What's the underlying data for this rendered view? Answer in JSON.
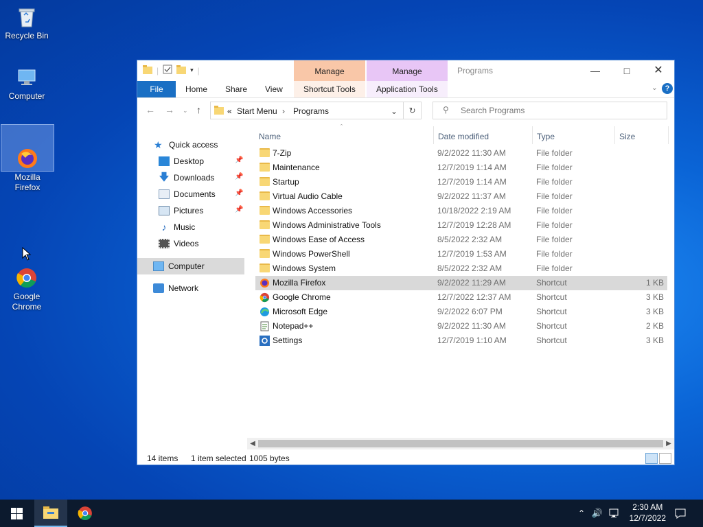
{
  "desktop": {
    "icons": [
      {
        "label": "Recycle Bin"
      },
      {
        "label": "Computer"
      },
      {
        "label": "Mozilla\nFirefox"
      },
      {
        "label": "Google\nChrome"
      }
    ]
  },
  "window": {
    "title": "Programs",
    "context_tabs": [
      {
        "header": "Manage",
        "tab": "Shortcut Tools",
        "color": "#f9c7a8"
      },
      {
        "header": "Manage",
        "tab": "Application Tools",
        "color": "#e8c6f6"
      }
    ],
    "ribbon_tabs": [
      "File",
      "Home",
      "Share",
      "View"
    ],
    "breadcrumb": {
      "prefix": "«",
      "items": [
        "Start Menu",
        "Programs"
      ]
    },
    "search": {
      "placeholder": "Search Programs"
    },
    "nav_pane": [
      {
        "label": "Quick access",
        "icon": "star-icon",
        "pinned": false
      },
      {
        "label": "Desktop",
        "icon": "desktop-icon",
        "pinned": true
      },
      {
        "label": "Downloads",
        "icon": "download-icon",
        "pinned": true
      },
      {
        "label": "Documents",
        "icon": "documents-icon",
        "pinned": true
      },
      {
        "label": "Pictures",
        "icon": "pictures-icon",
        "pinned": true
      },
      {
        "label": "Music",
        "icon": "music-icon",
        "pinned": false
      },
      {
        "label": "Videos",
        "icon": "videos-icon",
        "pinned": false
      },
      {
        "label": "Computer",
        "icon": "computer-icon",
        "pinned": false
      },
      {
        "label": "Network",
        "icon": "network-icon",
        "pinned": false
      }
    ],
    "columns": [
      "Name",
      "Date modified",
      "Type",
      "Size"
    ],
    "files": [
      {
        "name": "7-Zip",
        "date": "9/2/2022 11:30 AM",
        "type": "File folder",
        "size": "",
        "icon": "folder-icon"
      },
      {
        "name": "Maintenance",
        "date": "12/7/2019 1:14 AM",
        "type": "File folder",
        "size": "",
        "icon": "folder-icon"
      },
      {
        "name": "Startup",
        "date": "12/7/2019 1:14 AM",
        "type": "File folder",
        "size": "",
        "icon": "folder-icon"
      },
      {
        "name": "Virtual Audio Cable",
        "date": "9/2/2022 11:37 AM",
        "type": "File folder",
        "size": "",
        "icon": "folder-icon"
      },
      {
        "name": "Windows Accessories",
        "date": "10/18/2022 2:19 AM",
        "type": "File folder",
        "size": "",
        "icon": "folder-icon"
      },
      {
        "name": "Windows Administrative Tools",
        "date": "12/7/2019 12:28 AM",
        "type": "File folder",
        "size": "",
        "icon": "folder-icon"
      },
      {
        "name": "Windows Ease of Access",
        "date": "8/5/2022 2:32 AM",
        "type": "File folder",
        "size": "",
        "icon": "folder-icon"
      },
      {
        "name": "Windows PowerShell",
        "date": "12/7/2019 1:53 AM",
        "type": "File folder",
        "size": "",
        "icon": "folder-icon"
      },
      {
        "name": "Windows System",
        "date": "8/5/2022 2:32 AM",
        "type": "File folder",
        "size": "",
        "icon": "folder-icon"
      },
      {
        "name": "Mozilla Firefox",
        "date": "9/2/2022 11:29 AM",
        "type": "Shortcut",
        "size": "1 KB",
        "icon": "firefox-icon",
        "selected": true
      },
      {
        "name": "Google Chrome",
        "date": "12/7/2022 12:37 AM",
        "type": "Shortcut",
        "size": "3 KB",
        "icon": "chrome-icon"
      },
      {
        "name": "Microsoft Edge",
        "date": "9/2/2022 6:07 PM",
        "type": "Shortcut",
        "size": "3 KB",
        "icon": "edge-icon"
      },
      {
        "name": "Notepad++",
        "date": "9/2/2022 11:30 AM",
        "type": "Shortcut",
        "size": "2 KB",
        "icon": "notepadpp-icon"
      },
      {
        "name": "Settings",
        "date": "12/7/2019 1:10 AM",
        "type": "Shortcut",
        "size": "3 KB",
        "icon": "settings-icon"
      }
    ],
    "status": {
      "items": "14 items",
      "selected": "1 item selected",
      "size": "1005 bytes"
    }
  },
  "taskbar": {
    "time": "2:30 AM",
    "date": "12/7/2022"
  }
}
